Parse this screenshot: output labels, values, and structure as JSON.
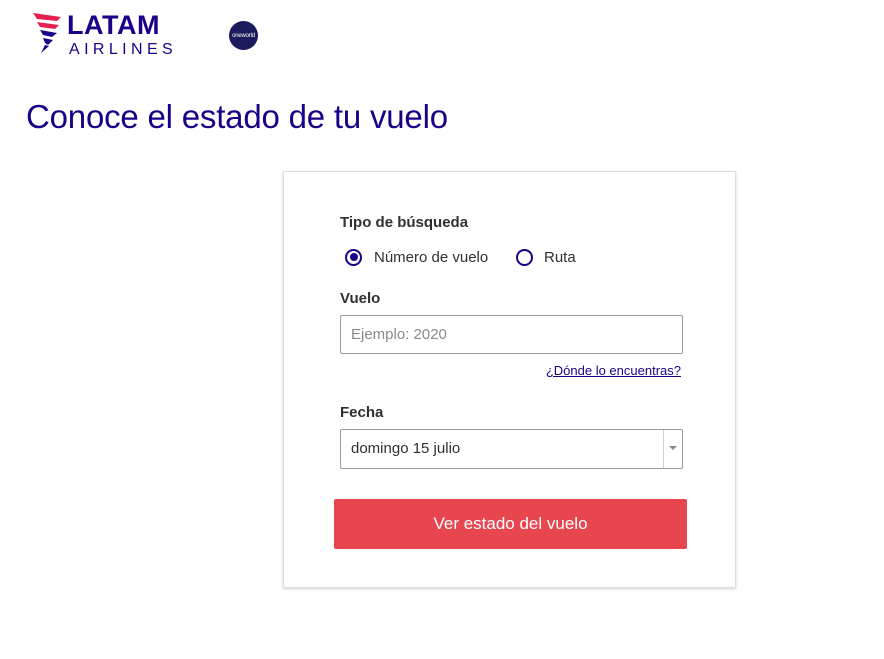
{
  "header": {
    "brand_name": "LATAM",
    "brand_sub": "AIRLINES",
    "alliance_badge": "oneworld"
  },
  "page": {
    "title": "Conoce el estado de tu vuelo"
  },
  "form": {
    "search_type_label": "Tipo de búsqueda",
    "search_type_options": [
      {
        "label": "Número de vuelo",
        "selected": true
      },
      {
        "label": "Ruta",
        "selected": false
      }
    ],
    "flight_label": "Vuelo",
    "flight_placeholder": "Ejemplo: 2020",
    "flight_value": "",
    "help_link": "¿Dónde lo encuentras?",
    "date_label": "Fecha",
    "date_value": "domingo 15 julio",
    "submit_label": "Ver estado del vuelo"
  },
  "colors": {
    "brand_primary": "#1b0088",
    "submit_button": "#e8464f",
    "logo_accent": "#e3224f"
  }
}
